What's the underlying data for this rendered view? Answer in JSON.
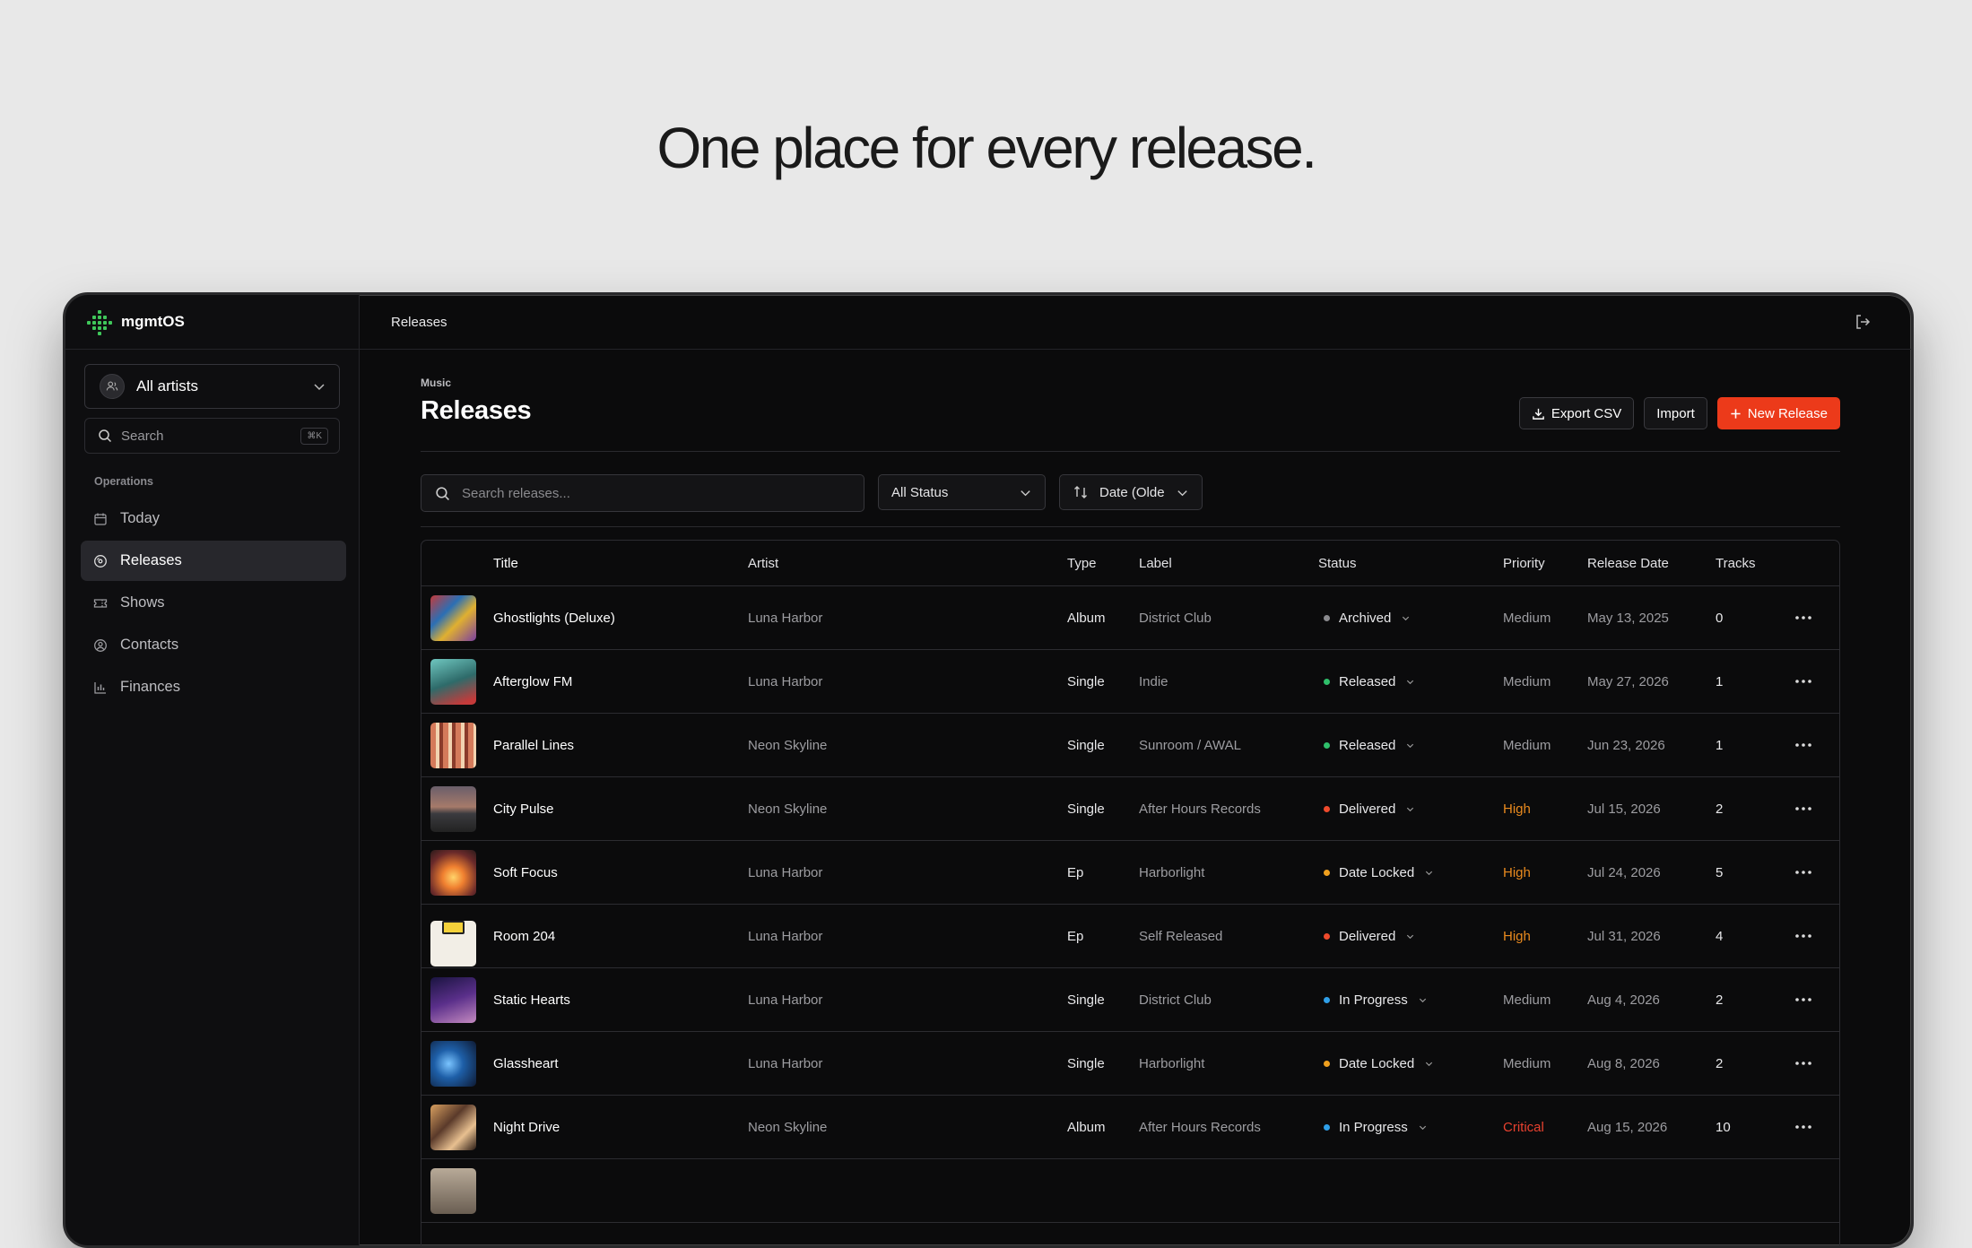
{
  "headline": "One place for every release.",
  "app": {
    "name": "mgmtOS"
  },
  "sidebar": {
    "artist_select": "All artists",
    "search_placeholder": "Search",
    "search_shortcut": "⌘K",
    "section": "Operations",
    "items": [
      {
        "label": "Today",
        "icon": "calendar-icon"
      },
      {
        "label": "Releases",
        "icon": "disc-icon",
        "active": true
      },
      {
        "label": "Shows",
        "icon": "ticket-icon"
      },
      {
        "label": "Contacts",
        "icon": "user-circle-icon"
      },
      {
        "label": "Finances",
        "icon": "bar-chart-icon"
      }
    ]
  },
  "topbar": {
    "title": "Releases",
    "exit_icon": "logout-icon"
  },
  "page": {
    "breadcrumb": "Music",
    "title": "Releases",
    "actions": {
      "export": "Export CSV",
      "import": "Import",
      "new": "New Release"
    },
    "filters": {
      "search_placeholder": "Search releases...",
      "status": "All Status",
      "sort": "Date (Olde"
    }
  },
  "colors": {
    "accent": "#ec3a1a",
    "archived": "#8a8a8e",
    "released": "#2fbf6b",
    "delivered": "#ef4a2c",
    "date_locked": "#f0a01e",
    "in_progress": "#2f9fe8"
  },
  "table": {
    "headers": {
      "title": "Title",
      "artist": "Artist",
      "type": "Type",
      "label": "Label",
      "status": "Status",
      "priority": "Priority",
      "release_date": "Release Date",
      "tracks": "Tracks"
    },
    "rows": [
      {
        "title": "Ghostlights (Deluxe)",
        "artist": "Luna Harbor",
        "type": "Album",
        "label": "District Club",
        "status": "Archived",
        "status_color": "#8a8a8e",
        "priority": "Medium",
        "date": "May 13, 2025",
        "tracks": "0"
      },
      {
        "title": "Afterglow FM",
        "artist": "Luna Harbor",
        "type": "Single",
        "label": "Indie",
        "status": "Released",
        "status_color": "#2fbf6b",
        "priority": "Medium",
        "date": "May 27, 2026",
        "tracks": "1"
      },
      {
        "title": "Parallel Lines",
        "artist": "Neon Skyline",
        "type": "Single",
        "label": "Sunroom / AWAL",
        "status": "Released",
        "status_color": "#2fbf6b",
        "priority": "Medium",
        "date": "Jun 23, 2026",
        "tracks": "1"
      },
      {
        "title": "City Pulse",
        "artist": "Neon Skyline",
        "type": "Single",
        "label": "After Hours Records",
        "status": "Delivered",
        "status_color": "#ef4a2c",
        "priority": "High",
        "date": "Jul 15, 2026",
        "tracks": "2"
      },
      {
        "title": "Soft Focus",
        "artist": "Luna Harbor",
        "type": "Ep",
        "label": "Harborlight",
        "status": "Date Locked",
        "status_color": "#f0a01e",
        "priority": "High",
        "date": "Jul 24, 2026",
        "tracks": "5"
      },
      {
        "title": "Room 204",
        "artist": "Luna Harbor",
        "type": "Ep",
        "label": "Self Released",
        "status": "Delivered",
        "status_color": "#ef4a2c",
        "priority": "High",
        "date": "Jul 31, 2026",
        "tracks": "4"
      },
      {
        "title": "Static Hearts",
        "artist": "Luna Harbor",
        "type": "Single",
        "label": "District Club",
        "status": "In Progress",
        "status_color": "#2f9fe8",
        "priority": "Medium",
        "date": "Aug 4, 2026",
        "tracks": "2"
      },
      {
        "title": "Glassheart",
        "artist": "Luna Harbor",
        "type": "Single",
        "label": "Harborlight",
        "status": "Date Locked",
        "status_color": "#f0a01e",
        "priority": "Medium",
        "date": "Aug 8, 2026",
        "tracks": "2"
      },
      {
        "title": "Night Drive",
        "artist": "Neon Skyline",
        "type": "Album",
        "label": "After Hours Records",
        "status": "In Progress",
        "status_color": "#2f9fe8",
        "priority": "Critical",
        "date": "Aug 15, 2026",
        "tracks": "10"
      }
    ]
  }
}
